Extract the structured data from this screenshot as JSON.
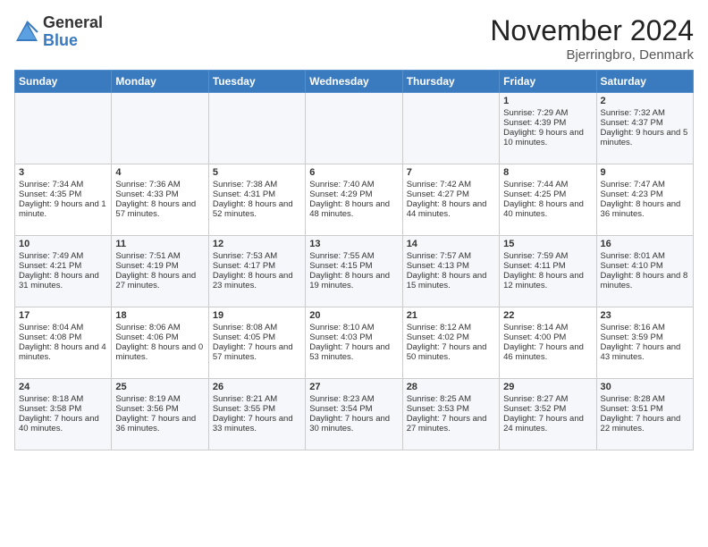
{
  "logo": {
    "general": "General",
    "blue": "Blue"
  },
  "title": "November 2024",
  "location": "Bjerringbro, Denmark",
  "headers": [
    "Sunday",
    "Monday",
    "Tuesday",
    "Wednesday",
    "Thursday",
    "Friday",
    "Saturday"
  ],
  "weeks": [
    [
      {
        "day": "",
        "sunrise": "",
        "sunset": "",
        "daylight": ""
      },
      {
        "day": "",
        "sunrise": "",
        "sunset": "",
        "daylight": ""
      },
      {
        "day": "",
        "sunrise": "",
        "sunset": "",
        "daylight": ""
      },
      {
        "day": "",
        "sunrise": "",
        "sunset": "",
        "daylight": ""
      },
      {
        "day": "",
        "sunrise": "",
        "sunset": "",
        "daylight": ""
      },
      {
        "day": "1",
        "sunrise": "Sunrise: 7:29 AM",
        "sunset": "Sunset: 4:39 PM",
        "daylight": "Daylight: 9 hours and 10 minutes."
      },
      {
        "day": "2",
        "sunrise": "Sunrise: 7:32 AM",
        "sunset": "Sunset: 4:37 PM",
        "daylight": "Daylight: 9 hours and 5 minutes."
      }
    ],
    [
      {
        "day": "3",
        "sunrise": "Sunrise: 7:34 AM",
        "sunset": "Sunset: 4:35 PM",
        "daylight": "Daylight: 9 hours and 1 minute."
      },
      {
        "day": "4",
        "sunrise": "Sunrise: 7:36 AM",
        "sunset": "Sunset: 4:33 PM",
        "daylight": "Daylight: 8 hours and 57 minutes."
      },
      {
        "day": "5",
        "sunrise": "Sunrise: 7:38 AM",
        "sunset": "Sunset: 4:31 PM",
        "daylight": "Daylight: 8 hours and 52 minutes."
      },
      {
        "day": "6",
        "sunrise": "Sunrise: 7:40 AM",
        "sunset": "Sunset: 4:29 PM",
        "daylight": "Daylight: 8 hours and 48 minutes."
      },
      {
        "day": "7",
        "sunrise": "Sunrise: 7:42 AM",
        "sunset": "Sunset: 4:27 PM",
        "daylight": "Daylight: 8 hours and 44 minutes."
      },
      {
        "day": "8",
        "sunrise": "Sunrise: 7:44 AM",
        "sunset": "Sunset: 4:25 PM",
        "daylight": "Daylight: 8 hours and 40 minutes."
      },
      {
        "day": "9",
        "sunrise": "Sunrise: 7:47 AM",
        "sunset": "Sunset: 4:23 PM",
        "daylight": "Daylight: 8 hours and 36 minutes."
      }
    ],
    [
      {
        "day": "10",
        "sunrise": "Sunrise: 7:49 AM",
        "sunset": "Sunset: 4:21 PM",
        "daylight": "Daylight: 8 hours and 31 minutes."
      },
      {
        "day": "11",
        "sunrise": "Sunrise: 7:51 AM",
        "sunset": "Sunset: 4:19 PM",
        "daylight": "Daylight: 8 hours and 27 minutes."
      },
      {
        "day": "12",
        "sunrise": "Sunrise: 7:53 AM",
        "sunset": "Sunset: 4:17 PM",
        "daylight": "Daylight: 8 hours and 23 minutes."
      },
      {
        "day": "13",
        "sunrise": "Sunrise: 7:55 AM",
        "sunset": "Sunset: 4:15 PM",
        "daylight": "Daylight: 8 hours and 19 minutes."
      },
      {
        "day": "14",
        "sunrise": "Sunrise: 7:57 AM",
        "sunset": "Sunset: 4:13 PM",
        "daylight": "Daylight: 8 hours and 15 minutes."
      },
      {
        "day": "15",
        "sunrise": "Sunrise: 7:59 AM",
        "sunset": "Sunset: 4:11 PM",
        "daylight": "Daylight: 8 hours and 12 minutes."
      },
      {
        "day": "16",
        "sunrise": "Sunrise: 8:01 AM",
        "sunset": "Sunset: 4:10 PM",
        "daylight": "Daylight: 8 hours and 8 minutes."
      }
    ],
    [
      {
        "day": "17",
        "sunrise": "Sunrise: 8:04 AM",
        "sunset": "Sunset: 4:08 PM",
        "daylight": "Daylight: 8 hours and 4 minutes."
      },
      {
        "day": "18",
        "sunrise": "Sunrise: 8:06 AM",
        "sunset": "Sunset: 4:06 PM",
        "daylight": "Daylight: 8 hours and 0 minutes."
      },
      {
        "day": "19",
        "sunrise": "Sunrise: 8:08 AM",
        "sunset": "Sunset: 4:05 PM",
        "daylight": "Daylight: 7 hours and 57 minutes."
      },
      {
        "day": "20",
        "sunrise": "Sunrise: 8:10 AM",
        "sunset": "Sunset: 4:03 PM",
        "daylight": "Daylight: 7 hours and 53 minutes."
      },
      {
        "day": "21",
        "sunrise": "Sunrise: 8:12 AM",
        "sunset": "Sunset: 4:02 PM",
        "daylight": "Daylight: 7 hours and 50 minutes."
      },
      {
        "day": "22",
        "sunrise": "Sunrise: 8:14 AM",
        "sunset": "Sunset: 4:00 PM",
        "daylight": "Daylight: 7 hours and 46 minutes."
      },
      {
        "day": "23",
        "sunrise": "Sunrise: 8:16 AM",
        "sunset": "Sunset: 3:59 PM",
        "daylight": "Daylight: 7 hours and 43 minutes."
      }
    ],
    [
      {
        "day": "24",
        "sunrise": "Sunrise: 8:18 AM",
        "sunset": "Sunset: 3:58 PM",
        "daylight": "Daylight: 7 hours and 40 minutes."
      },
      {
        "day": "25",
        "sunrise": "Sunrise: 8:19 AM",
        "sunset": "Sunset: 3:56 PM",
        "daylight": "Daylight: 7 hours and 36 minutes."
      },
      {
        "day": "26",
        "sunrise": "Sunrise: 8:21 AM",
        "sunset": "Sunset: 3:55 PM",
        "daylight": "Daylight: 7 hours and 33 minutes."
      },
      {
        "day": "27",
        "sunrise": "Sunrise: 8:23 AM",
        "sunset": "Sunset: 3:54 PM",
        "daylight": "Daylight: 7 hours and 30 minutes."
      },
      {
        "day": "28",
        "sunrise": "Sunrise: 8:25 AM",
        "sunset": "Sunset: 3:53 PM",
        "daylight": "Daylight: 7 hours and 27 minutes."
      },
      {
        "day": "29",
        "sunrise": "Sunrise: 8:27 AM",
        "sunset": "Sunset: 3:52 PM",
        "daylight": "Daylight: 7 hours and 24 minutes."
      },
      {
        "day": "30",
        "sunrise": "Sunrise: 8:28 AM",
        "sunset": "Sunset: 3:51 PM",
        "daylight": "Daylight: 7 hours and 22 minutes."
      }
    ]
  ]
}
